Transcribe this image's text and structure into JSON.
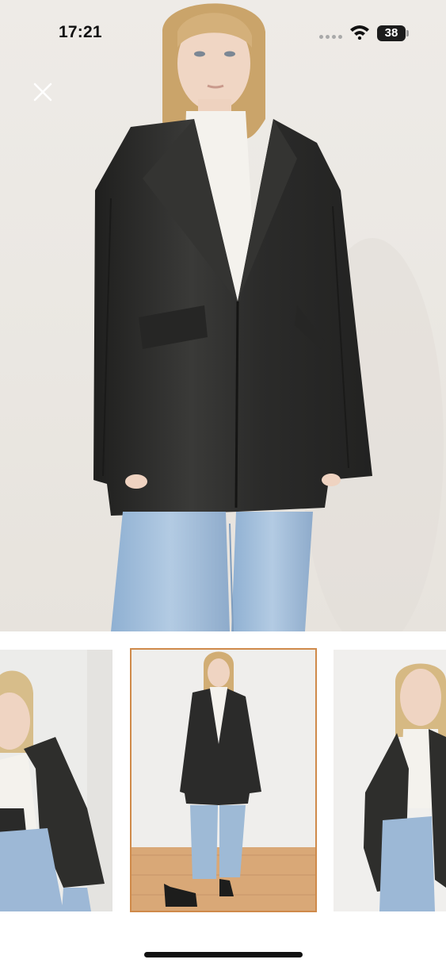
{
  "status_bar": {
    "time": "17:21",
    "battery_level": "38",
    "wifi_icon": "wifi-icon",
    "signal_icon": "cellular-signal-icon"
  },
  "viewer": {
    "close_icon": "close-icon",
    "main_image": "woman-black-leather-oversized-jacket-front",
    "selected_thumbnail_index": 1,
    "colors": {
      "selected_border": "#cf8a4a",
      "jacket": "#2a2a28",
      "jeans": "#9ebad6",
      "background": "#ebe8e3"
    }
  },
  "thumbnails": [
    {
      "image": "jacket-side-angle-closeup"
    },
    {
      "image": "jacket-full-length-with-boots"
    },
    {
      "image": "jacket-three-quarter-view"
    }
  ]
}
